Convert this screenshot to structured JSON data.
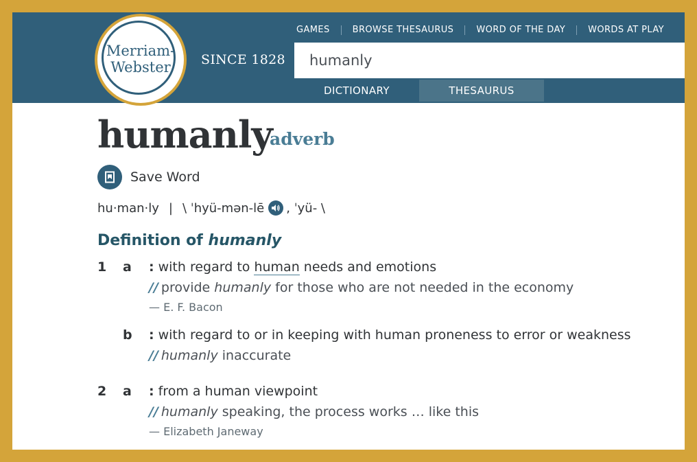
{
  "header": {
    "logo_line1": "Merriam-",
    "logo_line2": "Webster",
    "since": "SINCE 1828",
    "nav": [
      "GAMES",
      "BROWSE THESAURUS",
      "WORD OF THE DAY",
      "WORDS AT PLAY"
    ],
    "search_value": "humanly",
    "tabs": [
      {
        "label": "DICTIONARY",
        "selected": false
      },
      {
        "label": "THESAURUS",
        "selected": true
      }
    ]
  },
  "entry": {
    "headword": "humanly",
    "part_of_speech": "adverb",
    "save_label": "Save Word",
    "syllables": "hu·man·ly",
    "divider": "|",
    "pron_open": "\\ ˈhyü-mən-lē",
    "pron_close": ", ˈyü- \\",
    "definition_heading": "Definition of",
    "definition_heading_word": "humanly"
  },
  "senses": [
    {
      "number": "1",
      "letter": "a",
      "colon": ":",
      "text_pre": "with regard to",
      "link": "human",
      "text_post": "needs and emotions",
      "example_pre": "provide",
      "example_italic": "humanly",
      "example_post": "for those who are not needed in the economy",
      "attribution": "— E. F. Bacon"
    },
    {
      "number": "",
      "letter": "b",
      "colon": ":",
      "text": "with regard to or in keeping with human proneness to error or weakness",
      "example_italic": "humanly",
      "example_post": "inaccurate"
    },
    {
      "number": "2",
      "letter": "a",
      "colon": ":",
      "text": "from a human viewpoint",
      "example_italic": "humanly",
      "example_post": "speaking, the process works … like this",
      "attribution": "— Elizabeth Janeway"
    }
  ],
  "example_marker": "//",
  "colors": {
    "header_bg": "#305f7a",
    "selected_tab_bg": "#4b7489",
    "frame": "#d4a43a",
    "accent": "#4a7d95",
    "heading": "#265667"
  },
  "icons": [
    "bookmark-icon",
    "speaker-icon"
  ]
}
